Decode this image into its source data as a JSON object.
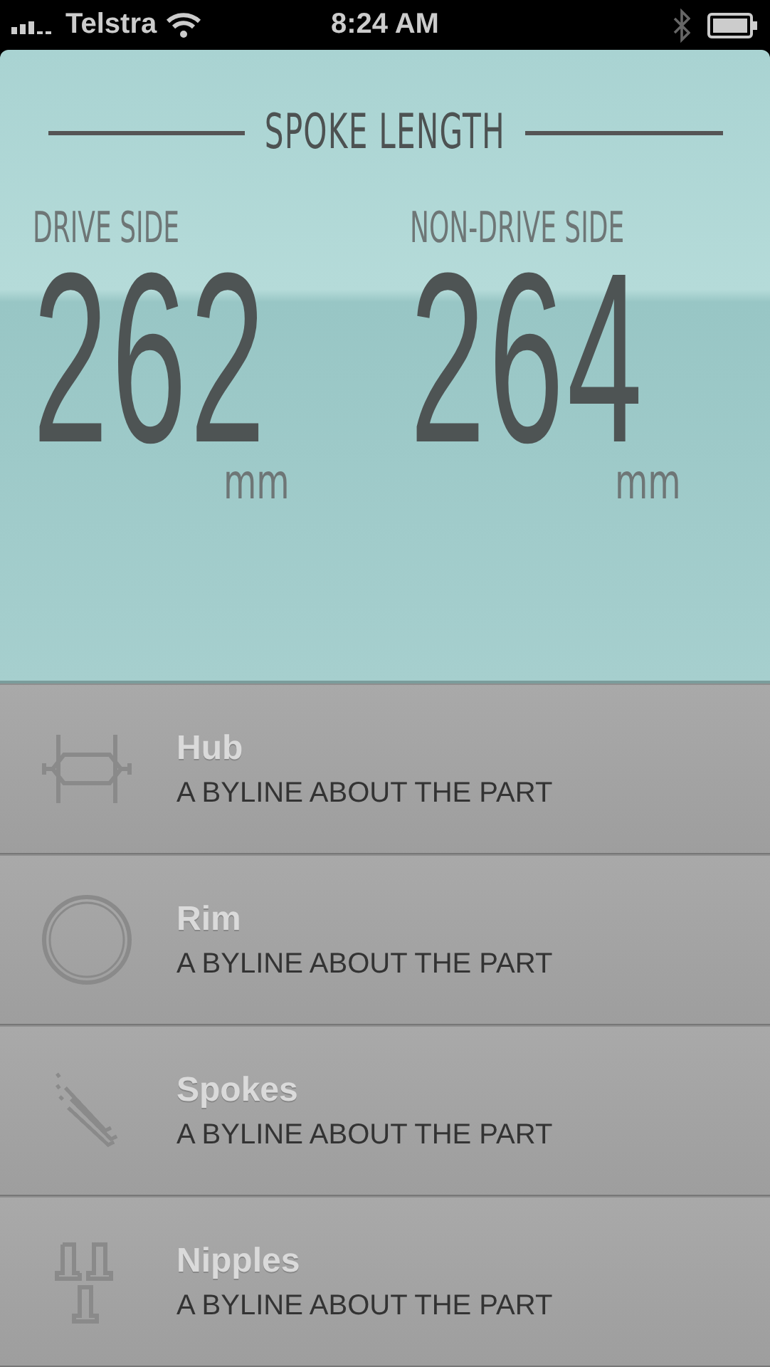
{
  "status_bar": {
    "carrier": "Telstra",
    "time": "8:24 AM"
  },
  "result": {
    "title": "SPOKE LENGTH",
    "sides": [
      {
        "label": "DRIVE SIDE",
        "value": "262",
        "unit": "mm"
      },
      {
        "label": "NON-DRIVE SIDE",
        "value": "264",
        "unit": "mm"
      }
    ]
  },
  "parts": [
    {
      "title": "Hub",
      "byline": "A BYLINE ABOUT THE PART"
    },
    {
      "title": "Rim",
      "byline": "A BYLINE ABOUT THE PART"
    },
    {
      "title": "Spokes",
      "byline": "A BYLINE ABOUT THE PART"
    },
    {
      "title": "Nipples",
      "byline": "A BYLINE ABOUT THE PART"
    }
  ]
}
